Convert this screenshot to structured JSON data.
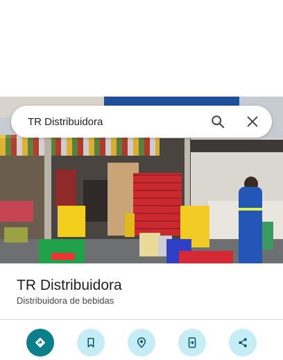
{
  "search": {
    "query": "TR Distribuidora"
  },
  "place": {
    "name": "TR Distribuidora",
    "category": "Distribuidora de bebidas"
  },
  "photo": {
    "description_icon": "street-view-photo"
  },
  "actions": [
    {
      "name": "directions",
      "icon": "directions-icon"
    },
    {
      "name": "save",
      "icon": "bookmark-icon"
    },
    {
      "name": "nearby",
      "icon": "nearby-pin-icon"
    },
    {
      "name": "send-to-phone",
      "icon": "send-to-phone-icon"
    },
    {
      "name": "share",
      "icon": "share-icon"
    }
  ],
  "colors": {
    "primary_action": "#0b7f8c",
    "secondary_action": "#c6ecf6",
    "icon_dark": "#0b5560"
  }
}
